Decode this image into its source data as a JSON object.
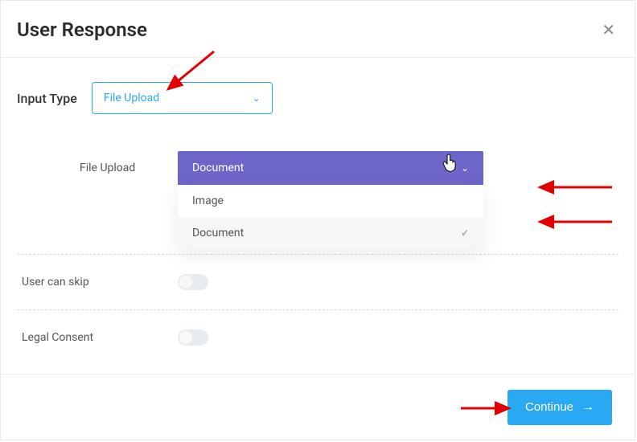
{
  "header": {
    "title": "User Response"
  },
  "input_type": {
    "label": "Input Type",
    "value": "File Upload"
  },
  "file_upload": {
    "label": "File Upload",
    "selected": "Document",
    "options": [
      "Image",
      "Document"
    ]
  },
  "skip": {
    "label": "User can skip",
    "value": false
  },
  "legal": {
    "label": "Legal Consent",
    "value": false
  },
  "footer": {
    "continue": "Continue"
  }
}
